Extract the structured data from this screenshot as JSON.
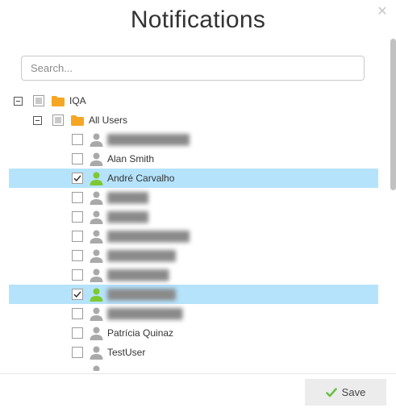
{
  "dialog": {
    "title": "Notifications",
    "close_icon": "close-icon",
    "search": {
      "placeholder": "Search...",
      "value": ""
    },
    "save_label": "Save",
    "save_icon": "checkmark-icon",
    "colors": {
      "selected_row": "#b5e3fb",
      "folder": "#f5a623",
      "user_active": "#7ec832",
      "user_inactive": "#a9a9a9",
      "save_check": "#6cc04a"
    }
  },
  "tree": {
    "root": {
      "label": "IQA",
      "expanded": true,
      "check_state": "partial",
      "icon": "folder-icon"
    },
    "group": {
      "label": "All Users",
      "expanded": true,
      "check_state": "partial",
      "icon": "folder-icon"
    },
    "users": [
      {
        "label": "████████████",
        "checked": false,
        "obscured": true
      },
      {
        "label": "Alan Smith",
        "checked": false,
        "obscured": false
      },
      {
        "label": "André Carvalho",
        "checked": true,
        "obscured": false
      },
      {
        "label": "██████",
        "checked": false,
        "obscured": true
      },
      {
        "label": "██████",
        "checked": false,
        "obscured": true
      },
      {
        "label": "████████████",
        "checked": false,
        "obscured": true
      },
      {
        "label": "██████████",
        "checked": false,
        "obscured": true
      },
      {
        "label": "█████████",
        "checked": false,
        "obscured": true
      },
      {
        "label": "██████████",
        "checked": true,
        "obscured": true
      },
      {
        "label": "███████████",
        "checked": false,
        "obscured": true
      },
      {
        "label": "Patrícia Quinaz",
        "checked": false,
        "obscured": false
      },
      {
        "label": "TestUser",
        "checked": false,
        "obscured": false
      }
    ]
  }
}
